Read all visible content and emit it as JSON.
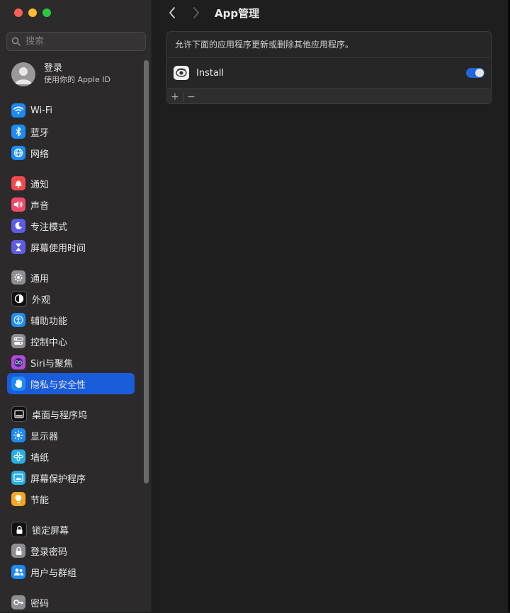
{
  "window": {
    "traffic_lights": [
      "#fe5f57",
      "#febc2e",
      "#28c840"
    ]
  },
  "sidebar": {
    "search_placeholder": "搜索",
    "account": {
      "name": "登录",
      "subtitle": "使用你的 Apple ID"
    },
    "items": [
      {
        "label": "Wi-Fi",
        "icon": "wifi-icon",
        "color": "#1c8bf4"
      },
      {
        "label": "蓝牙",
        "icon": "bluetooth-icon",
        "color": "#1c8bf4"
      },
      {
        "label": "网络",
        "icon": "globe-icon",
        "color": "#1c8bf4"
      },
      {
        "label": "通知",
        "icon": "bell-icon",
        "color": "#f24a4a"
      },
      {
        "label": "声音",
        "icon": "speaker-icon",
        "color": "#f24a6a"
      },
      {
        "label": "专注模式",
        "icon": "moon-icon",
        "color": "#5e5ce6"
      },
      {
        "label": "屏幕使用时间",
        "icon": "hourglass-icon",
        "color": "#5e5ce6"
      },
      {
        "label": "通用",
        "icon": "gear-icon",
        "color": "#8e8e93"
      },
      {
        "label": "外观",
        "icon": "appearance-icon",
        "color": "#111111"
      },
      {
        "label": "辅助功能",
        "icon": "accessibility-icon",
        "color": "#1c8bf4"
      },
      {
        "label": "控制中心",
        "icon": "control-center-icon",
        "color": "#8e8e93"
      },
      {
        "label": "Siri与聚焦",
        "icon": "siri-icon",
        "color": "#b04ad8"
      },
      {
        "label": "隐私与安全性",
        "icon": "hand-icon",
        "color": "#1c8bf4",
        "selected": true
      },
      {
        "label": "桌面与程序坞",
        "icon": "dock-icon",
        "color": "#111111"
      },
      {
        "label": "显示器",
        "icon": "sun-icon",
        "color": "#1c8bf4"
      },
      {
        "label": "墙纸",
        "icon": "flower-icon",
        "color": "#27aee6"
      },
      {
        "label": "屏幕保护程序",
        "icon": "screensaver-icon",
        "color": "#27aee6"
      },
      {
        "label": "节能",
        "icon": "bulb-icon",
        "color": "#f5a623"
      },
      {
        "label": "锁定屏幕",
        "icon": "lock-icon",
        "color": "#111111"
      },
      {
        "label": "登录密码",
        "icon": "lock-icon",
        "color": "#8e8e93"
      },
      {
        "label": "用户与群组",
        "icon": "users-icon",
        "color": "#1c8bf4"
      },
      {
        "label": "密码",
        "icon": "key-icon",
        "color": "#8e8e93"
      }
    ]
  },
  "main": {
    "title": "App管理",
    "description": "允许下面的应用程序更新或删除其他应用程序。",
    "apps": [
      {
        "name": "Install",
        "enabled": true
      }
    ],
    "add_label": "+",
    "remove_label": "−"
  }
}
